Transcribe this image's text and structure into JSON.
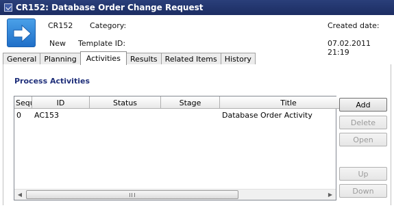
{
  "window": {
    "title": "CR152: Database Order Change Request"
  },
  "header": {
    "id": "CR152",
    "category_label": "Category:",
    "created_label": "Created date:",
    "state": "New",
    "template_label": "Template ID:",
    "created_value": "07.02.2011 21:19"
  },
  "tabs": [
    {
      "label": "General"
    },
    {
      "label": "Planning"
    },
    {
      "label": "Activities",
      "active": true
    },
    {
      "label": "Results"
    },
    {
      "label": "Related Items"
    },
    {
      "label": "History"
    }
  ],
  "section": {
    "title": "Process Activities"
  },
  "grid": {
    "columns": [
      "Sequ",
      "ID",
      "Status",
      "Stage",
      "Title"
    ],
    "rows": [
      {
        "seq": "0",
        "id": "AC153",
        "status": "",
        "stage": "",
        "title": "Database Order Activity"
      }
    ]
  },
  "buttons": {
    "add": "Add",
    "delete": "Delete",
    "open": "Open",
    "up": "Up",
    "down": "Down"
  },
  "colors": {
    "titlebar": "#1c2d62",
    "section_title": "#1f2f7a",
    "icon_blue": "#1f6fc8"
  }
}
